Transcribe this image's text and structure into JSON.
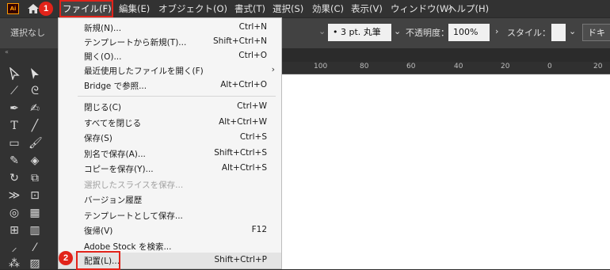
{
  "app": {
    "logo": "Ai"
  },
  "menubar": {
    "items": [
      "ファイル(F)",
      "編集(E)",
      "オブジェクト(O)",
      "書式(T)",
      "選択(S)",
      "効果(C)",
      "表示(V)",
      "ウィンドウ(W)",
      "ヘルプ(H)"
    ]
  },
  "badges": {
    "first": "1",
    "second": "2"
  },
  "controlbar": {
    "selection": "選択なし",
    "stroke_profile": "3 pt. 丸筆",
    "opacity_label": "不透明度：",
    "opacity_value": "100%",
    "style_label": "スタイル：",
    "doc_setup": "ドキ"
  },
  "ruler": {
    "ticks": [
      "100",
      "80",
      "60",
      "40",
      "20",
      "0",
      "20"
    ]
  },
  "file_menu": {
    "items": [
      {
        "label": "新規(N)...",
        "shortcut": "Ctrl+N"
      },
      {
        "label": "テンプレートから新規(T)...",
        "shortcut": "Shift+Ctrl+N"
      },
      {
        "label": "開く(O)...",
        "shortcut": "Ctrl+O"
      },
      {
        "label": "最近使用したファイルを開く(F)",
        "shortcut": ""
      },
      {
        "label": "Bridge で参照...",
        "shortcut": "Alt+Ctrl+O"
      },
      {
        "label": "閉じる(C)",
        "shortcut": "Ctrl+W"
      },
      {
        "label": "すべてを閉じる",
        "shortcut": "Alt+Ctrl+W"
      },
      {
        "label": "保存(S)",
        "shortcut": "Ctrl+S"
      },
      {
        "label": "別名で保存(A)...",
        "shortcut": "Shift+Ctrl+S"
      },
      {
        "label": "コピーを保存(Y)...",
        "shortcut": "Alt+Ctrl+S"
      },
      {
        "label": "選択したスライスを保存...",
        "shortcut": ""
      },
      {
        "label": "バージョン履歴",
        "shortcut": ""
      },
      {
        "label": "テンプレートとして保存...",
        "shortcut": ""
      },
      {
        "label": "復帰(V)",
        "shortcut": "F12"
      },
      {
        "label": "Adobe Stock を検索...",
        "shortcut": ""
      },
      {
        "label": "配置(L)...",
        "shortcut": "Shift+Ctrl+P"
      }
    ]
  },
  "colors": {
    "highlight": "#e2231a",
    "menu_bg": "#f5f5f5",
    "app_bg": "#323232"
  }
}
